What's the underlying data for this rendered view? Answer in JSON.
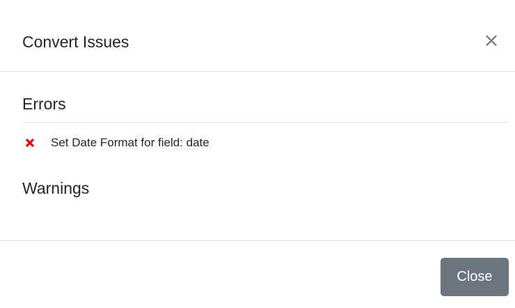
{
  "modal": {
    "title": "Convert Issues",
    "close_glyph": "×",
    "errors": {
      "heading": "Errors",
      "items": [
        {
          "text": "Set Date Format for field: date"
        }
      ]
    },
    "warnings": {
      "heading": "Warnings",
      "items": []
    },
    "footer": {
      "close_label": "Close"
    }
  },
  "colors": {
    "error_icon": "#e00000",
    "secondary_button": "#6c757d",
    "divider": "#dee2e6"
  }
}
